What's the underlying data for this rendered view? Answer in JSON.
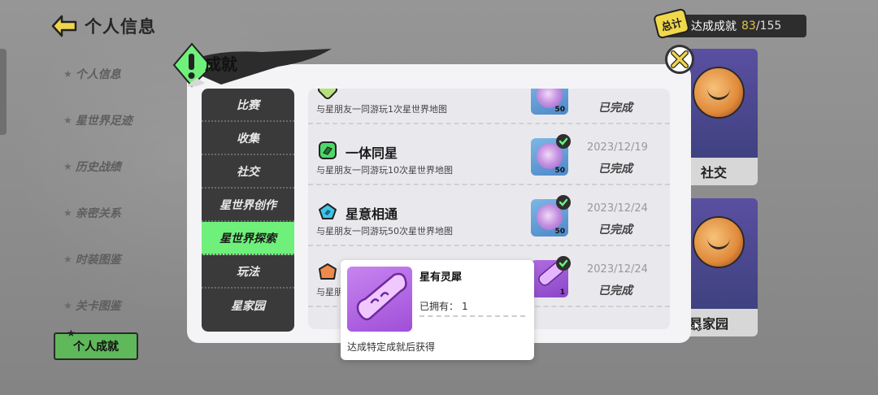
{
  "header": {
    "title": "个人信息",
    "icon": "back-arrow-icon"
  },
  "total": {
    "tag": "总计",
    "label": "达成成就",
    "achieved": "83",
    "separator": "/",
    "total": "155"
  },
  "sidebar": {
    "items": [
      {
        "label": "个人信息"
      },
      {
        "label": "星世界足迹"
      },
      {
        "label": "历史战绩"
      },
      {
        "label": "亲密关系"
      },
      {
        "label": "时装图鉴"
      },
      {
        "label": "关卡图鉴"
      }
    ],
    "active": {
      "label": "个人成就"
    }
  },
  "cards": [
    {
      "label": "社交"
    },
    {
      "label": "星家园"
    }
  ],
  "modal": {
    "title": "成就",
    "close_icon": "close-icon",
    "categories": [
      {
        "label": "比赛"
      },
      {
        "label": "收集"
      },
      {
        "label": "社交"
      },
      {
        "label": "星世界创作"
      },
      {
        "label": "星世界探索",
        "active": true
      },
      {
        "label": "玩法"
      },
      {
        "label": "星家园"
      }
    ],
    "achievements": [
      {
        "name": "",
        "desc": "与星朋友一同游玩1次星世界地图",
        "date": "",
        "status": "已完成",
        "reward_count": "50",
        "icon_color": "#b6e07a"
      },
      {
        "name": "一体同星",
        "desc": "与星朋友一同游玩10次星世界地图",
        "date": "2023/12/19",
        "status": "已完成",
        "reward_count": "50",
        "icon_color": "#4fd86a"
      },
      {
        "name": "星意相通",
        "desc": "与星朋友一同游玩50次星世界地图",
        "date": "2023/12/24",
        "status": "已完成",
        "reward_count": "50",
        "icon_color": "#3ec5e8"
      },
      {
        "name": "",
        "desc": "与星朋",
        "date": "2023/12/24",
        "status": "已完成",
        "reward_count": "1",
        "icon_color": "#f08a4a"
      }
    ]
  },
  "tooltip": {
    "name": "星有灵犀",
    "owned_label": "已拥有：",
    "owned_value": "1",
    "desc": "达成特定成就后获得"
  },
  "colors": {
    "accent_green": "#6ff07a",
    "active_side": "#5fb85a",
    "gold": "#e0c34a"
  }
}
